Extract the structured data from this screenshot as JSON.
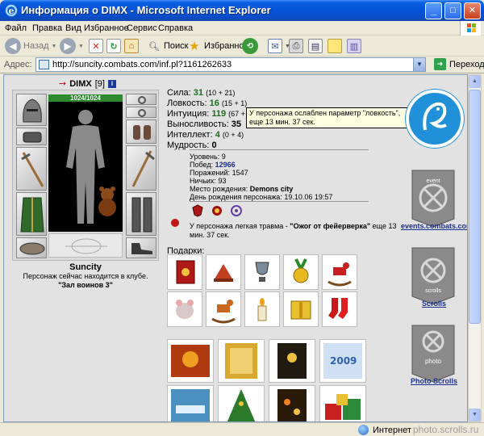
{
  "window": {
    "title": "Информация о DIMX - Microsoft Internet Explorer",
    "minimize": "_",
    "maximize": "□",
    "close": "✕"
  },
  "menu": [
    "Файл",
    "Правка",
    "Вид",
    "Избранное",
    "Сервис",
    "Справка"
  ],
  "toolbar": {
    "back": "Назад",
    "search": "Поиск",
    "favorites": "Избранное"
  },
  "address": {
    "label": "Адрес:",
    "url": "http://suncity.combats.com/inf.pl?1161262633",
    "go": "Переход"
  },
  "status": {
    "zone": "Интернет",
    "watermark": "photo.scrolls.ru"
  },
  "character": {
    "name": "DIMX",
    "level_badge": "[9]",
    "hp": "1024/1024",
    "city": "Suncity",
    "club_text": "Персонаж сейчас находится в клубе.",
    "club_room": "\"Зал воинов 3\""
  },
  "stats": [
    {
      "label": "Сила:",
      "value": "31",
      "mod": "(10 + 21)",
      "color": "green"
    },
    {
      "label": "Ловкость:",
      "value": "16",
      "mod": "(15 + 1)",
      "color": "green"
    },
    {
      "label": "Интуиция:",
      "value": "119",
      "mod": "(67 +",
      "color": "green"
    },
    {
      "label": "Выносливость:",
      "value": "35",
      "mod": "",
      "color": "black"
    },
    {
      "label": "Интеллект:",
      "value": "4",
      "mod": "(0 + 4)",
      "color": "green"
    },
    {
      "label": "Мудрость:",
      "value": "0",
      "mod": "",
      "color": "black"
    }
  ],
  "tooltip": "У персонажа ослаблен параметр \"ловкость\", еще 13 мин. 37 сек.",
  "info": {
    "level_label": "Уровень:",
    "level": "9",
    "wins_label": "Побед:",
    "wins": "12966",
    "losses_label": "Поражений:",
    "losses": "1547",
    "draws_label": "Ничьих:",
    "draws": "93",
    "birthplace_label": "Место рождения:",
    "birthplace": "Demons city",
    "birthday_label": "День рождения персонажа:",
    "birthday": "19.10.06 19:57"
  },
  "injury": {
    "prefix": "У персонажа легкая травма -",
    "name": "\"Ожог от фейерверка\"",
    "suffix": "еще 13 мин. 37 сек."
  },
  "gifts_title": "Подарки:",
  "side": {
    "events": "events.combats.com",
    "scrolls": "Scrolls",
    "photo": "Photo Scrolls",
    "banner_events": "event",
    "banner_scrolls": "scrolls",
    "banner_photo": "photo"
  },
  "colors": {
    "xp_blue": "#0553d8",
    "stat_green": "#1e6e1e",
    "link_blue": "#1a2f8e",
    "hp_green": "#2e8a2e",
    "dragon_blue": "#2090d8"
  }
}
